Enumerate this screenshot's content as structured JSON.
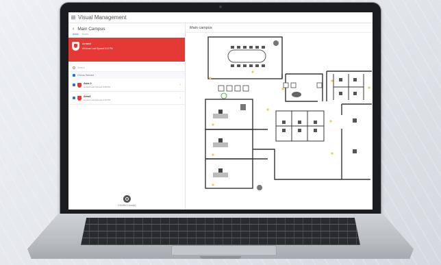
{
  "app": {
    "title": "Visual Management"
  },
  "left_panel": {
    "campus_title": "Main Campus",
    "tabs": [
      {
        "label": "Areas",
        "active": true
      },
      {
        "label": "Doors",
        "active": false
      }
    ],
    "alarm_banner": {
      "title": "Armed",
      "subtitle": "All Areas: Last Synced 3:13 PM",
      "color": "#e53935"
    },
    "search": {
      "placeholder": "Search"
    },
    "selection_summary": "2 Areas Selected",
    "areas": [
      {
        "name": "Area 2",
        "status": "Armed, Last Synced 3:08 PM"
      },
      {
        "name": "Area1",
        "status": "Armed, Last Synced 3:13 PM"
      }
    ],
    "disarm": {
      "label": "DISARM 2 Area(s)"
    }
  },
  "map": {
    "title": "Main campus"
  },
  "icons": [
    "menu-icon",
    "back-arrow-icon",
    "shield-icon",
    "search-icon",
    "checkbox-icon",
    "chevron-right-icon",
    "disarm-icon",
    "camera-icon",
    "lock-icon",
    "door-icon"
  ],
  "colors": {
    "alarm": "#e53935",
    "accent": "#2a6fd6",
    "device": "#f2c94c"
  }
}
